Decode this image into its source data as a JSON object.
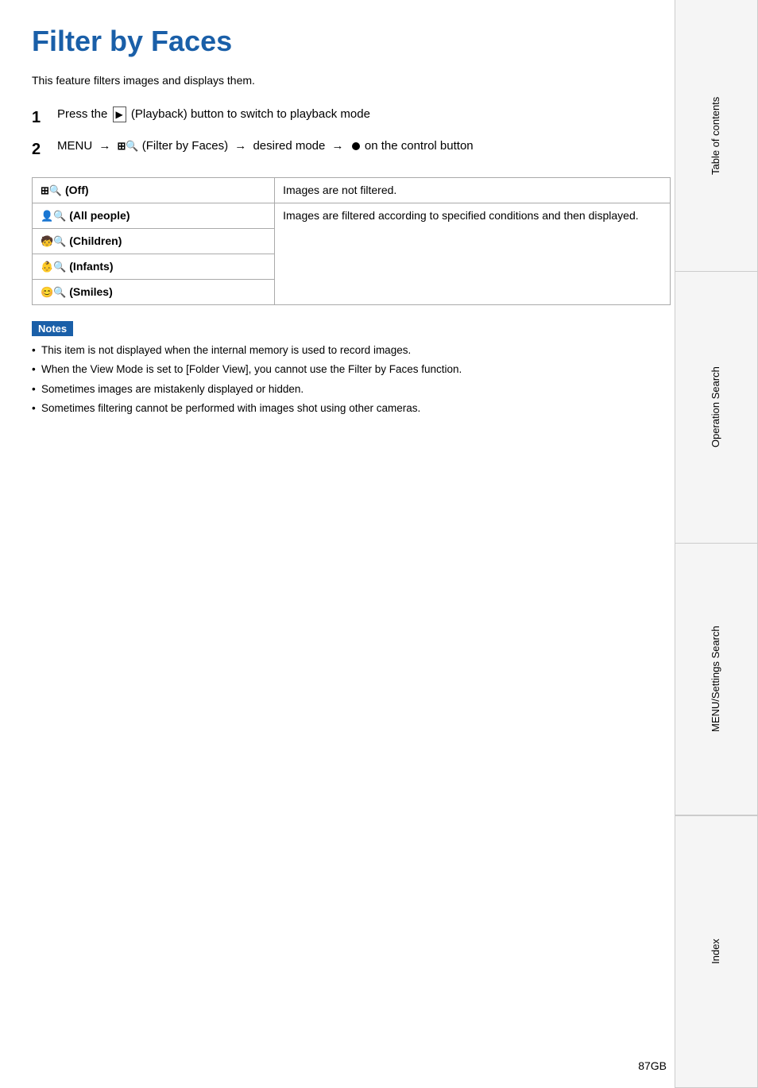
{
  "page": {
    "title": "Filter by Faces",
    "intro": "This feature filters images and displays them.",
    "steps": [
      {
        "number": "1",
        "text": "Press the [▶] (Playback) button to switch to playback mode"
      },
      {
        "number": "2",
        "text": "MENU → 🔍 (Filter by Faces) → desired mode → ● on the control button"
      }
    ],
    "table": {
      "rows": [
        {
          "label": "⚙🔍 (Off)",
          "description": "Images are not filtered."
        },
        {
          "label": "👥🔍 (All people)",
          "description": "Images are filtered according to specified conditions and then displayed."
        },
        {
          "label": "🧒🔍 (Children)",
          "description": ""
        },
        {
          "label": "👶🔍 (Infants)",
          "description": ""
        },
        {
          "label": "😊🔍 (Smiles)",
          "description": ""
        }
      ]
    },
    "notes": {
      "label": "Notes",
      "items": [
        "This item is not displayed when the internal memory is used to record images.",
        "When the View Mode is set to [Folder View], you cannot use the Filter by Faces function.",
        "Sometimes images are mistakenly displayed or hidden.",
        "Sometimes filtering cannot be performed with images shot using other cameras."
      ]
    },
    "page_number": "87GB"
  },
  "sidebar": {
    "tabs": [
      {
        "label": "Table of contents"
      },
      {
        "label": "Operation Search"
      },
      {
        "label": "MENU/Settings Search"
      },
      {
        "label": "Index"
      }
    ]
  }
}
